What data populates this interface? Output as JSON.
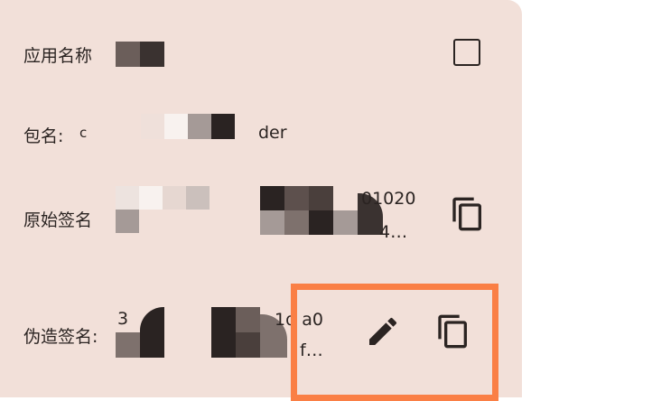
{
  "app_info": {
    "app_name_label": "应用名称",
    "package_label": "包名:",
    "package_prefix": "c",
    "package_suffix": "der",
    "original_sig_label": "原始签名",
    "original_sig_line1": "01020",
    "original_sig_line2": "4…",
    "fake_sig_label": "伪造签名:",
    "fake_sig_prefix": "3",
    "fake_sig_line1": "1d a0",
    "fake_sig_line2": "f…"
  },
  "icons": {
    "checkbox": "checkbox-unchecked-icon",
    "copy": "copy-icon",
    "edit": "pencil-icon"
  },
  "colors": {
    "card_background": "#f2e0d9",
    "highlight": "#fa7f45",
    "text": "#2b2422"
  }
}
